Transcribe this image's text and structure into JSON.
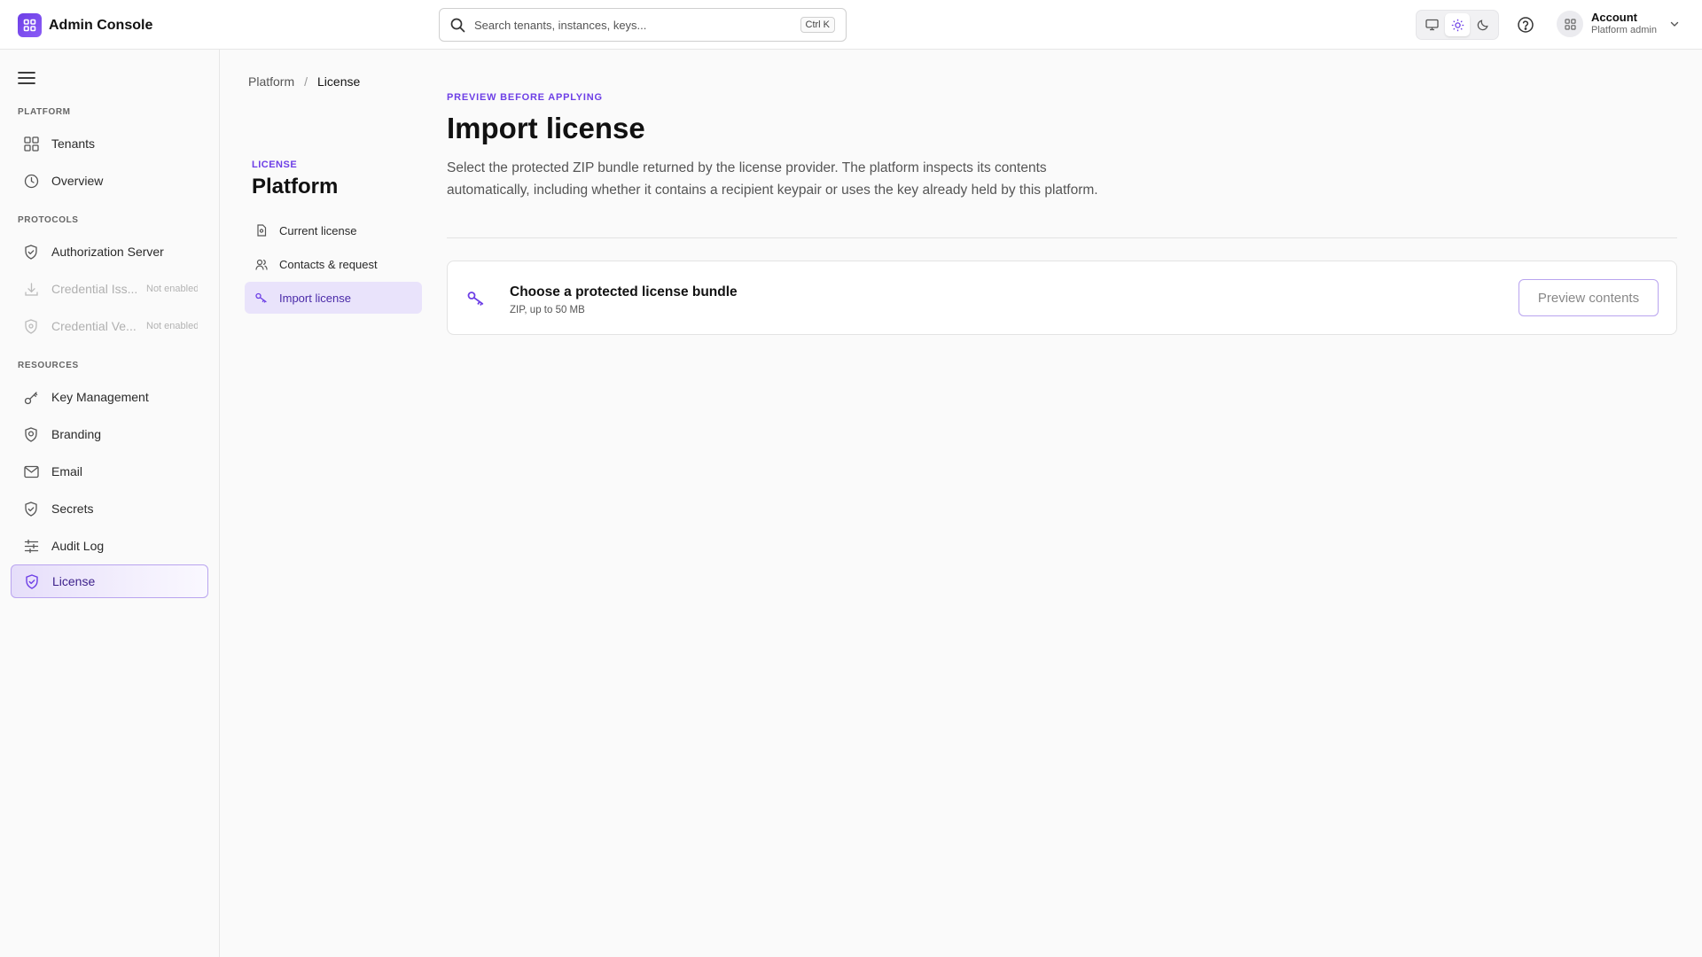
{
  "app": {
    "title": "Admin Console"
  },
  "search": {
    "placeholder": "Search tenants, instances, keys...",
    "shortcut": "Ctrl K"
  },
  "account": {
    "name": "Account",
    "role": "Platform admin"
  },
  "theme": {
    "options": [
      "system",
      "light",
      "dark"
    ],
    "selected": "light"
  },
  "colors": {
    "accent": "#6d3fe6",
    "accent_soft": "#e9e3fb"
  },
  "sidebar": {
    "sections": {
      "platform": "PLATFORM",
      "protocols": "PROTOCOLS",
      "resources": "RESOURCES"
    },
    "items": {
      "tenants": {
        "label": "Tenants",
        "icon": "grid-icon"
      },
      "overview": {
        "label": "Overview",
        "icon": "clock-icon"
      },
      "authorization_server": {
        "label": "Authorization Server",
        "icon": "shield-icon"
      },
      "credential_issuer": {
        "label": "Credential Iss...",
        "tag": "Not enabled",
        "icon": "download-icon"
      },
      "credential_verifier": {
        "label": "Credential Ve...",
        "tag": "Not enabled",
        "icon": "shield-icon"
      },
      "key_management": {
        "label": "Key Management",
        "icon": "key-icon"
      },
      "branding": {
        "label": "Branding",
        "icon": "badge-icon"
      },
      "email": {
        "label": "Email",
        "icon": "mail-icon"
      },
      "secrets": {
        "label": "Secrets",
        "icon": "shield-icon"
      },
      "audit_log": {
        "label": "Audit Log",
        "icon": "sliders-icon"
      },
      "license": {
        "label": "License",
        "icon": "shield-check-icon"
      }
    }
  },
  "breadcrumb": {
    "parent": "Platform",
    "separator": "/",
    "current": "License"
  },
  "subnav": {
    "eyebrow": "LICENSE",
    "title": "Platform",
    "items": {
      "current_license": "Current license",
      "contacts_request": "Contacts & request",
      "import_license": "Import license"
    }
  },
  "main": {
    "eyebrow": "PREVIEW BEFORE APPLYING",
    "title": "Import license",
    "description": "Select the protected ZIP bundle returned by the license provider. The platform inspects its contents automatically, including whether it contains a recipient keypair or uses the key already held by this platform.",
    "upload": {
      "title": "Choose a protected license bundle",
      "subtitle": "ZIP, up to 50 MB",
      "button": "Preview contents"
    }
  }
}
